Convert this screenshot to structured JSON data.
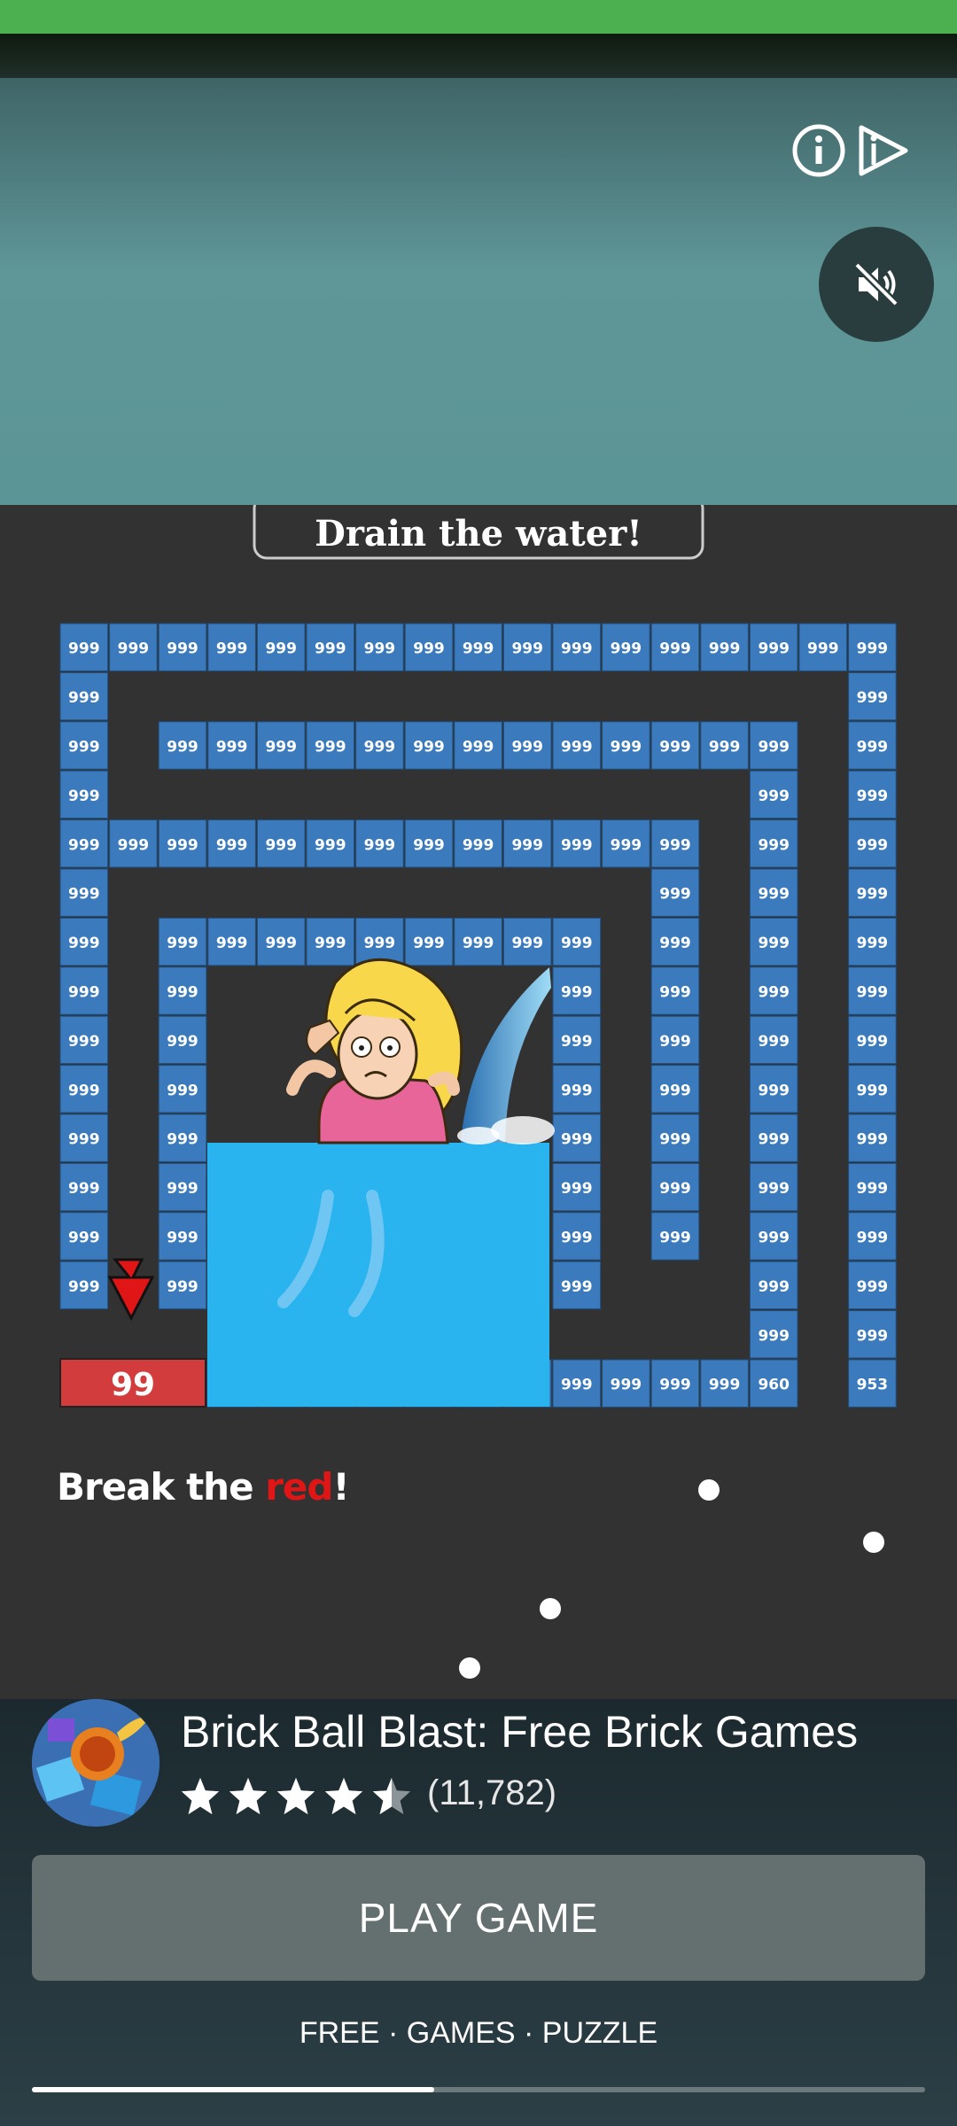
{
  "ad_controls": {
    "info_icon": "info-icon",
    "adchoices_icon": "adchoices-icon",
    "mute_icon": "speaker-muted-icon"
  },
  "game": {
    "prompt": "Drain the water!",
    "brick_value": "999",
    "special_values": [
      "960",
      "953"
    ],
    "red_brick_value": "99",
    "hint_prefix": "Break the ",
    "hint_highlight": "red",
    "hint_suffix": "!",
    "colors": {
      "background": "#323232",
      "brick": "#3b7bbd",
      "red_brick": "#d23c3c",
      "water": "#29b4f0"
    }
  },
  "app": {
    "title": "Brick Ball Blast: Free Brick Games",
    "rating": 4.5,
    "rating_count": "(11,782)",
    "play_label": "PLAY GAME",
    "categories": "FREE · GAMES · PUZZLE",
    "progress": 0.45
  }
}
